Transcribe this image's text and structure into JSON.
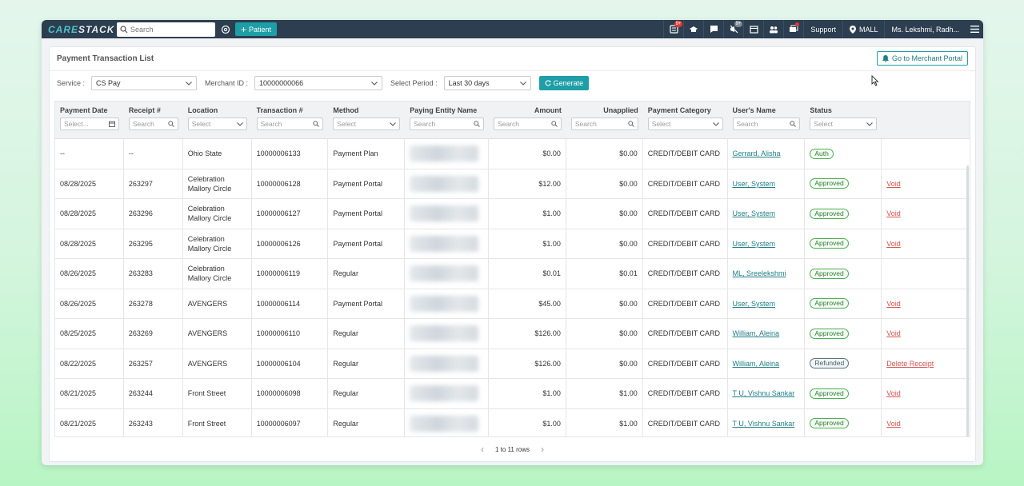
{
  "brand": {
    "part1": "CARE",
    "part2": "STACK"
  },
  "topbar": {
    "search_placeholder": "Search",
    "patient_label": "Patient",
    "badges": {
      "tasks": "9+",
      "alerts": "9+"
    },
    "support_label": "Support",
    "location_label": "MALL",
    "user_label": "Ms. Lekshmi, Radh..."
  },
  "page": {
    "title": "Payment Transaction List",
    "merchant_portal_label": "Go to Merchant Portal"
  },
  "filters": {
    "service_label": "Service :",
    "service_value": "CS Pay",
    "merchant_label": "Merchant ID :",
    "merchant_value": "10000000066",
    "period_label": "Select Period :",
    "period_value": "Last 30 days",
    "generate_label": "Generate"
  },
  "columns": [
    {
      "label": "Payment Date",
      "filter": "Select...",
      "type": "date"
    },
    {
      "label": "Receipt #",
      "filter": "Search",
      "type": "search"
    },
    {
      "label": "Location",
      "filter": "Select",
      "type": "select"
    },
    {
      "label": "Transaction #",
      "filter": "Search",
      "type": "search"
    },
    {
      "label": "Method",
      "filter": "Select",
      "type": "select"
    },
    {
      "label": "Paying Entity Name",
      "filter": "Search",
      "type": "search"
    },
    {
      "label": "Amount",
      "filter": "Search",
      "type": "search"
    },
    {
      "label": "Unapplied",
      "filter": "Search",
      "type": "search"
    },
    {
      "label": "Payment Category",
      "filter": "Select",
      "type": "select"
    },
    {
      "label": "User's Name",
      "filter": "Search",
      "type": "search"
    },
    {
      "label": "Status",
      "filter": "Select",
      "type": "select"
    },
    {
      "label": "",
      "filter": "",
      "type": "none"
    }
  ],
  "rows": [
    {
      "date": "--",
      "receipt": "--",
      "location": "Ohio State",
      "txn": "10000006133",
      "method": "Payment Plan",
      "amount": "$0.00",
      "unapplied": "$0.00",
      "category": "CREDIT/DEBIT CARD",
      "user": "Gerrard, Alisha",
      "status": "Auth",
      "action": ""
    },
    {
      "date": "08/28/2025",
      "receipt": "263297",
      "location": "Celebration Mallory Circle",
      "txn": "10000006128",
      "method": "Payment Portal",
      "amount": "$12.00",
      "unapplied": "$0.00",
      "category": "CREDIT/DEBIT CARD",
      "user": "User, System",
      "status": "Approved",
      "action": "Void"
    },
    {
      "date": "08/28/2025",
      "receipt": "263296",
      "location": "Celebration Mallory Circle",
      "txn": "10000006127",
      "method": "Payment Portal",
      "amount": "$1.00",
      "unapplied": "$0.00",
      "category": "CREDIT/DEBIT CARD",
      "user": "User, System",
      "status": "Approved",
      "action": "Void"
    },
    {
      "date": "08/28/2025",
      "receipt": "263295",
      "location": "Celebration Mallory Circle",
      "txn": "10000006126",
      "method": "Payment Portal",
      "amount": "$1.00",
      "unapplied": "$0.00",
      "category": "CREDIT/DEBIT CARD",
      "user": "User, System",
      "status": "Approved",
      "action": "Void"
    },
    {
      "date": "08/26/2025",
      "receipt": "263283",
      "location": "Celebration Mallory Circle",
      "txn": "10000006119",
      "method": "Regular",
      "amount": "$0.01",
      "unapplied": "$0.01",
      "category": "CREDIT/DEBIT CARD",
      "user": "ML, Sreelekshmi",
      "status": "Approved",
      "action": ""
    },
    {
      "date": "08/26/2025",
      "receipt": "263278",
      "location": "AVENGERS",
      "txn": "10000006114",
      "method": "Payment Portal",
      "amount": "$45.00",
      "unapplied": "$0.00",
      "category": "CREDIT/DEBIT CARD",
      "user": "User, System",
      "status": "Approved",
      "action": "Void"
    },
    {
      "date": "08/25/2025",
      "receipt": "263269",
      "location": "AVENGERS",
      "txn": "10000006110",
      "method": "Regular",
      "amount": "$126.00",
      "unapplied": "$0.00",
      "category": "CREDIT/DEBIT CARD",
      "user": "William, Aleina",
      "status": "Approved",
      "action": "Void"
    },
    {
      "date": "08/22/2025",
      "receipt": "263257",
      "location": "AVENGERS",
      "txn": "10000006104",
      "method": "Regular",
      "amount": "$126.00",
      "unapplied": "$0.00",
      "category": "CREDIT/DEBIT CARD",
      "user": "William, Aleina",
      "status": "Refunded",
      "action": "Delete Receipt"
    },
    {
      "date": "08/21/2025",
      "receipt": "263244",
      "location": "Front Street",
      "txn": "10000006098",
      "method": "Regular",
      "amount": "$1.00",
      "unapplied": "$1.00",
      "category": "CREDIT/DEBIT CARD",
      "user": "T U, Vishnu Sankar",
      "status": "Approved",
      "action": "Void"
    },
    {
      "date": "08/21/2025",
      "receipt": "263243",
      "location": "Front Street",
      "txn": "10000006097",
      "method": "Regular",
      "amount": "$1.00",
      "unapplied": "$1.00",
      "category": "CREDIT/DEBIT CARD",
      "user": "T U, Vishnu Sankar",
      "status": "Approved",
      "action": "Void"
    }
  ],
  "pager": {
    "label": "1 to 11 rows"
  }
}
